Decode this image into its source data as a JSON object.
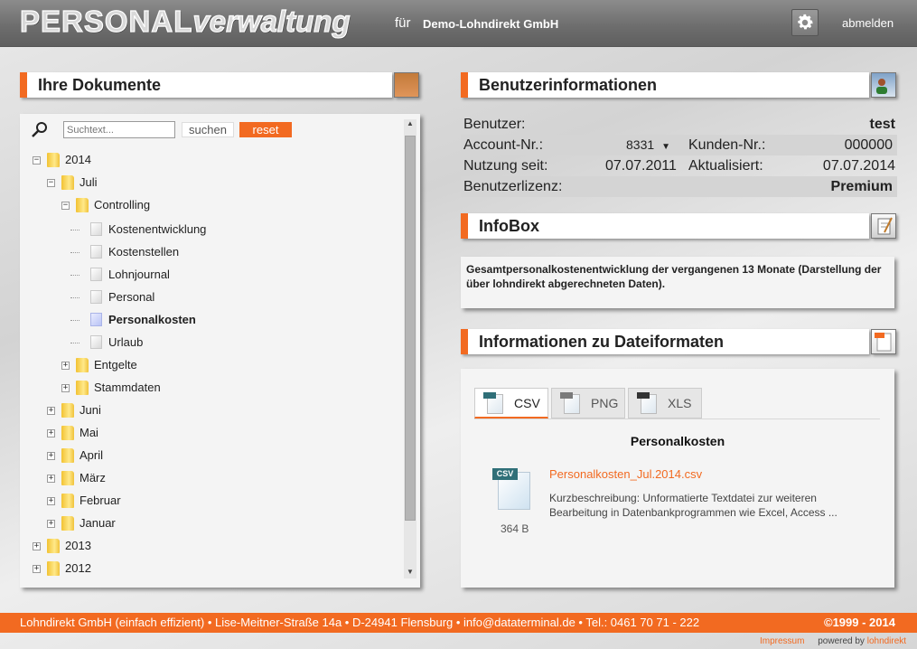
{
  "header": {
    "logo_caps": "PERSONAL",
    "logo_rest": "verwaltung",
    "fuer": "für",
    "company": "Demo-Lohndirekt GmbH",
    "logout": "abmelden"
  },
  "documents": {
    "title": "Ihre Dokumente",
    "search_placeholder": "Suchtext...",
    "search_label": "suchen",
    "reset_label": "reset",
    "tree": [
      {
        "label": "2014",
        "type": "folder",
        "level": 0,
        "expander": "minus"
      },
      {
        "label": "Juli",
        "type": "folder",
        "level": 1,
        "expander": "minus"
      },
      {
        "label": "Controlling",
        "type": "folder",
        "level": 2,
        "expander": "minus"
      },
      {
        "label": "Kostenentwicklung",
        "type": "doc",
        "level": 3
      },
      {
        "label": "Kostenstellen",
        "type": "doc",
        "level": 3
      },
      {
        "label": "Lohnjournal",
        "type": "doc",
        "level": 3
      },
      {
        "label": "Personal",
        "type": "doc",
        "level": 3
      },
      {
        "label": "Personalkosten",
        "type": "doc",
        "level": 3,
        "active": true
      },
      {
        "label": "Urlaub",
        "type": "doc",
        "level": 3
      },
      {
        "label": "Entgelte",
        "type": "folder",
        "level": 2,
        "expander": "plus"
      },
      {
        "label": "Stammdaten",
        "type": "folder",
        "level": 2,
        "expander": "plus"
      },
      {
        "label": "Juni",
        "type": "folder",
        "level": 1,
        "expander": "plus"
      },
      {
        "label": "Mai",
        "type": "folder",
        "level": 1,
        "expander": "plus"
      },
      {
        "label": "April",
        "type": "folder",
        "level": 1,
        "expander": "plus"
      },
      {
        "label": "März",
        "type": "folder",
        "level": 1,
        "expander": "plus"
      },
      {
        "label": "Februar",
        "type": "folder",
        "level": 1,
        "expander": "plus"
      },
      {
        "label": "Januar",
        "type": "folder",
        "level": 1,
        "expander": "plus"
      },
      {
        "label": "2013",
        "type": "folder",
        "level": 0,
        "expander": "plus"
      },
      {
        "label": "2012",
        "type": "folder",
        "level": 0,
        "expander": "plus"
      }
    ]
  },
  "userinfo": {
    "title": "Benutzerinformationen",
    "benutzer_label": "Benutzer:",
    "benutzer_value": "test",
    "account_label": "Account-Nr.:",
    "account_value": "8331",
    "kunden_label": "Kunden-Nr.:",
    "kunden_value": "000000",
    "nutzung_label": "Nutzung seit:",
    "nutzung_value": "07.07.2011",
    "aktualisiert_label": "Aktualisiert:",
    "aktualisiert_value": "07.07.2014",
    "lizenz_label": "Benutzerlizenz:",
    "lizenz_value": "Premium"
  },
  "infobox": {
    "title": "InfoBox",
    "text": "Gesamtpersonalkostenentwicklung der vergangenen 13 Monate (Darstellung der über lohndirekt abgerechneten Daten)."
  },
  "fileformats": {
    "title": "Informationen zu Dateiformaten",
    "tabs": [
      {
        "label": "CSV",
        "active": true
      },
      {
        "label": "PNG",
        "active": false
      },
      {
        "label": "XLS",
        "active": false
      }
    ],
    "file_title": "Personalkosten",
    "file_name": "Personalkosten_Jul.2014.csv",
    "description": "Kurzbeschreibung: Unformatierte Textdatei zur weiteren Bearbeitung in Datenbankprogrammen wie Excel, Access ...",
    "file_size": "364 B",
    "big_icon_tag": "CSV"
  },
  "footer": {
    "text": "Lohndirekt GmbH (einfach effizient) • Lise-Meitner-Straße 14a • D-24941 Flensburg • info@dataterminal.de • Tel.: 0461 70 71 - 222",
    "copyright": "©1999 - 2014",
    "impressum": "Impressum",
    "powered_by": "powered by",
    "powered_name": "lohndirekt"
  },
  "colors": {
    "accent": "#f26a21",
    "header_bg": "#6e6e6e",
    "panel_bg": "#f4f4f4",
    "row_shade": "#d4d4d4"
  },
  "icons": {
    "gear": "gear-icon",
    "search": "magnifier-icon",
    "documents_section": "folder-book-icon",
    "user_section": "user-card-icon",
    "infobox_section": "clipboard-icon",
    "fileformats_section": "file-document-icon"
  }
}
